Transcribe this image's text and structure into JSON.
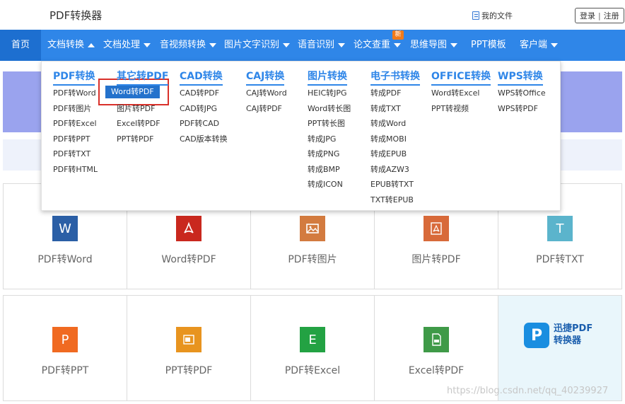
{
  "header": {
    "logo_text": "PDF转换器",
    "my_files": "我的文件",
    "login": "登录",
    "separator": "|",
    "register": "注册"
  },
  "nav": {
    "items": [
      {
        "label": "首页"
      },
      {
        "label": "文档转换"
      },
      {
        "label": "文档处理"
      },
      {
        "label": "音视频转换"
      },
      {
        "label": "图片文字识别"
      },
      {
        "label": "语音识别"
      },
      {
        "label": "论文查重"
      },
      {
        "label": "思维导图"
      },
      {
        "label": "PPT模板"
      },
      {
        "label": "客户端"
      }
    ],
    "badge": "新"
  },
  "dropdown": {
    "columns": [
      {
        "title": "PDF转换",
        "links": [
          "PDF转Word",
          "PDF转图片",
          "PDF转Excel",
          "PDF转PPT",
          "PDF转TXT",
          "PDF转HTML"
        ]
      },
      {
        "title": "其它转PDF",
        "links": [
          "Word转PDF",
          "图片转PDF",
          "Excel转PDF",
          "PPT转PDF"
        ]
      },
      {
        "title": "CAD转换",
        "links": [
          "CAD转PDF",
          "CAD转JPG",
          "PDF转CAD",
          "CAD版本转换"
        ]
      },
      {
        "title": "CAJ转换",
        "links": [
          "CAJ转Word",
          "CAJ转PDF"
        ]
      },
      {
        "title": "图片转换",
        "links": [
          "HEIC转JPG",
          "Word转长图",
          "PPT转长图",
          "转成JPG",
          "转成PNG",
          "转成BMP",
          "转成ICON"
        ]
      },
      {
        "title": "电子书转换",
        "links": [
          "转成PDF",
          "转成TXT",
          "转成Word",
          "转成MOBI",
          "转成EPUB",
          "转成AZW3",
          "EPUB转TXT",
          "TXT转EPUB"
        ]
      },
      {
        "title": "OFFICE转换",
        "links": [
          "Word转Excel",
          "PPT转视频"
        ]
      },
      {
        "title": "WPS转换",
        "links": [
          "WPS转Office",
          "WPS转PDF"
        ]
      }
    ]
  },
  "tools": {
    "row1": [
      {
        "label": "PDF转Word",
        "icon": "word-icon",
        "color": "#2b5fa6",
        "glyph": "W"
      },
      {
        "label": "Word转PDF",
        "icon": "pdf-acrobat-icon",
        "color": "#c9281e",
        "glyph": ""
      },
      {
        "label": "PDF转图片",
        "icon": "image-icon",
        "color": "#d37b3f",
        "glyph": ""
      },
      {
        "label": "图片转PDF",
        "icon": "pdf-acrobat-icon",
        "color": "#d86a3a",
        "glyph": ""
      },
      {
        "label": "PDF转TXT",
        "icon": "text-icon",
        "color": "#5bb4cc",
        "glyph": "T"
      }
    ],
    "row2": [
      {
        "label": "PDF转PPT",
        "icon": "powerpoint-icon",
        "color": "#f06a21",
        "glyph": "P"
      },
      {
        "label": "PPT转PDF",
        "icon": "ppt-pdf-icon",
        "color": "#e8941f",
        "glyph": ""
      },
      {
        "label": "PDF转Excel",
        "icon": "excel-icon",
        "color": "#23a243",
        "glyph": "E"
      },
      {
        "label": "Excel转PDF",
        "icon": "excel-pdf-icon",
        "color": "#3f9a48",
        "glyph": ""
      }
    ],
    "brand": {
      "line1": "迅捷PDF",
      "line2": "转换器",
      "logo_glyph": "P"
    }
  },
  "watermark": "https://blog.csdn.net/qq_40239927"
}
